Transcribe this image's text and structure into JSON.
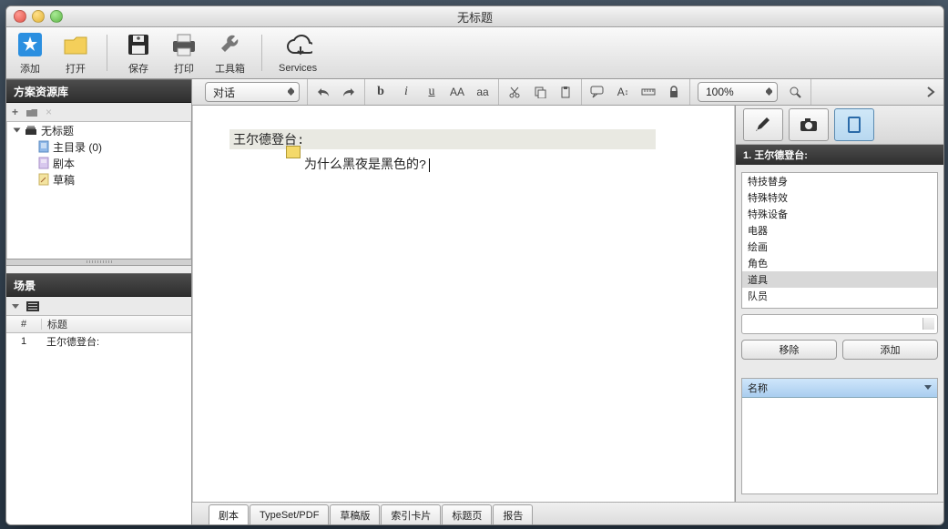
{
  "window": {
    "title": "无标题"
  },
  "toolbar": {
    "add": "添加",
    "open": "打开",
    "save": "保存",
    "print": "打印",
    "toolbox": "工具箱",
    "services": "Services"
  },
  "left": {
    "library_title": "方案资源库",
    "tree": {
      "root": "无标题",
      "mainlist": "主目录 (0)",
      "script": "剧本",
      "draft": "草稿"
    },
    "scenes_title": "场景",
    "scenes": {
      "col_num": "#",
      "col_title": "标题",
      "rows": [
        {
          "num": "1",
          "title": "王尔德登台:"
        }
      ]
    }
  },
  "format": {
    "element_type": "对话",
    "zoom": "100%"
  },
  "script": {
    "heading": "王尔德登台:",
    "dialogue": "为什么黑夜是黑色的?"
  },
  "bottom_tabs": {
    "t1": "剧本",
    "t2": "TypeSet/PDF",
    "t3": "草稿版",
    "t4": "索引卡片",
    "t5": "标题页",
    "t6": "报告"
  },
  "inspector": {
    "title": "1. 王尔德登台:",
    "list": [
      "特技替身",
      "特殊特效",
      "特殊设备",
      "电器",
      "绘画",
      "角色",
      "道具",
      "队员"
    ],
    "selected_index": 6,
    "remove": "移除",
    "add": "添加",
    "name_header": "名称"
  }
}
